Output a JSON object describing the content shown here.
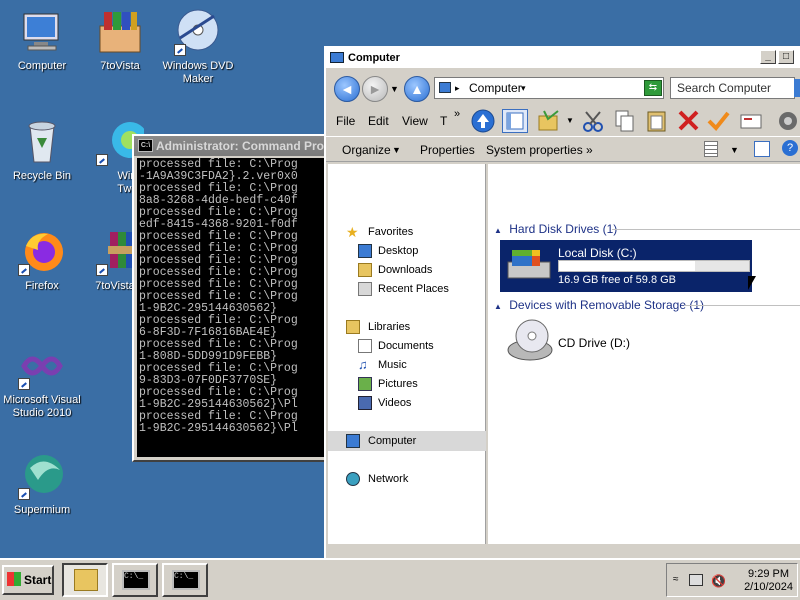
{
  "desktop": {
    "icons": [
      {
        "label": "Computer"
      },
      {
        "label": "7toVista"
      },
      {
        "label": "Windows DVD Maker"
      },
      {
        "label": "Recycle Bin"
      },
      {
        "label": "Winaero Tweaker"
      },
      {
        "label": "Firefox"
      },
      {
        "label": "7toVista"
      },
      {
        "label": "Microsoft Visual Studio 2010"
      },
      {
        "label": "Supermium"
      }
    ]
  },
  "cmd": {
    "title": "Administrator: Command Prompt",
    "lines": [
      "processed file: C:\\Prog",
      "-1A9A39C3FDA2}.2.ver0x0",
      "processed file: C:\\Prog",
      "8a8-3268-4dde-bedf-c40f",
      "processed file: C:\\Prog",
      "edf-8415-4368-9201-f0df",
      "processed file: C:\\Prog",
      "processed file: C:\\Prog",
      "processed file: C:\\Prog",
      "processed file: C:\\Prog",
      "processed file: C:\\Prog",
      "processed file: C:\\Prog",
      "1-9B2C-295144630562}",
      "processed file: C:\\Prog",
      "6-8F3D-7F16816BAE4E}",
      "processed file: C:\\Prog",
      "1-808D-5DD991D9FEBB}",
      "processed file: C:\\Prog",
      "9-83D3-07F0DF3770SE}",
      "processed file: C:\\Prog",
      "1-9B2C-295144630562}\\Pl",
      "processed file: C:\\Prog",
      "1-9B2C-295144630562}\\Pl"
    ]
  },
  "explorer": {
    "title": "Computer",
    "address": "Computer",
    "search_placeholder": "Search Computer",
    "menu": {
      "file": "File",
      "edit": "Edit",
      "view": "View",
      "tools": "T"
    },
    "commands": {
      "organize": "Organize",
      "properties": "Properties",
      "system_properties": "System properties",
      "more": "»"
    },
    "nav": {
      "favorites": "Favorites",
      "desktop": "Desktop",
      "downloads": "Downloads",
      "recent": "Recent Places",
      "libraries": "Libraries",
      "documents": "Documents",
      "music": "Music",
      "pictures": "Pictures",
      "videos": "Videos",
      "computer": "Computer",
      "network": "Network"
    },
    "groups": {
      "hdd": "Hard Disk Drives (1)",
      "removable": "Devices with Removable Storage (1)"
    },
    "drives": {
      "c_name": "Local Disk (C:)",
      "c_free": "16.9 GB free of 59.8 GB",
      "c_used_fraction": 0.717,
      "d_name": "CD Drive (D:)"
    }
  },
  "taskbar": {
    "start": "Start",
    "time": "9:29 PM",
    "date": "2/10/2024"
  }
}
